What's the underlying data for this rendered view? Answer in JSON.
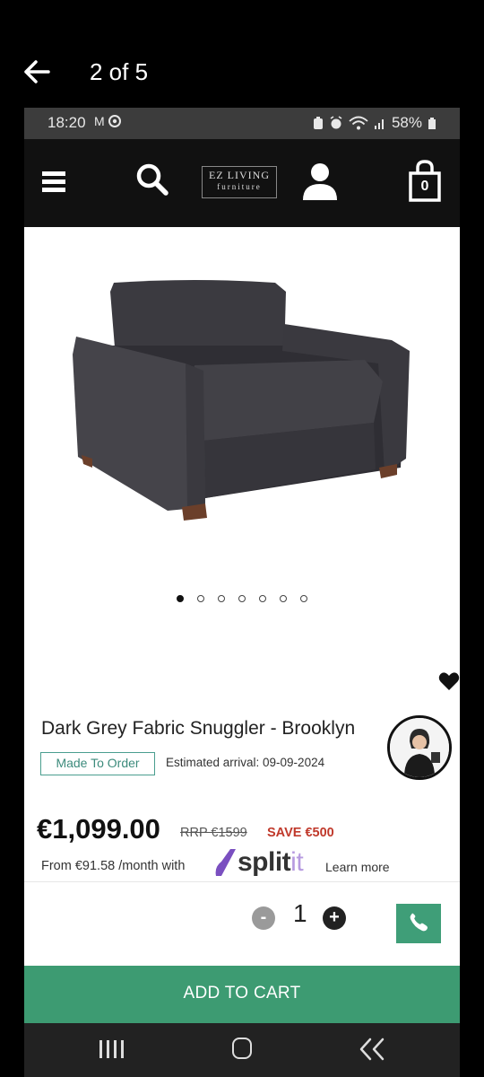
{
  "viewer": {
    "counter": "2 of 5",
    "back_icon": "arrow-left-icon"
  },
  "status_bar": {
    "time": "18:20",
    "left_icons": [
      "gmail-icon",
      "chrome-icon"
    ],
    "right_icons": [
      "battery-saver-icon",
      "alarm-icon",
      "wifi-icon",
      "signal-icon"
    ],
    "battery": "58%"
  },
  "header": {
    "menu_icon": "hamburger-icon",
    "search_icon": "search-icon",
    "logo_line1": "EZ LIVING",
    "logo_line2": "furniture",
    "account_icon": "user-icon",
    "cart_icon": "shopping-bag-icon",
    "cart_count": "0",
    "background": "#111111"
  },
  "gallery": {
    "image_subject": "dark grey fabric snuggler chair",
    "dots_total": 7,
    "active_dot": 1
  },
  "product": {
    "title": "Dark Grey Fabric Snuggler - Brooklyn",
    "badge": "Made To Order",
    "estimated_arrival": "Estimated arrival: 09-09-2024",
    "price": "€1,099.00",
    "rrp": "RRP €1599",
    "save": "SAVE €500",
    "finance_text": "From €91.58 /month with",
    "finance_brand_main": "split",
    "finance_brand_suffix": "it",
    "learn_more": "Learn more",
    "wishlist_icon": "heart-icon",
    "advisor_icon": "advisor-avatar"
  },
  "quantity": {
    "minus": "-",
    "value": "1",
    "plus": "+",
    "call_icon": "phone-icon"
  },
  "cta": {
    "label": "ADD TO CART",
    "color": "#3d9b72"
  },
  "nav": {
    "recents_icon": "recents-icon",
    "home_icon": "home-icon",
    "back_icon": "back-icon"
  }
}
